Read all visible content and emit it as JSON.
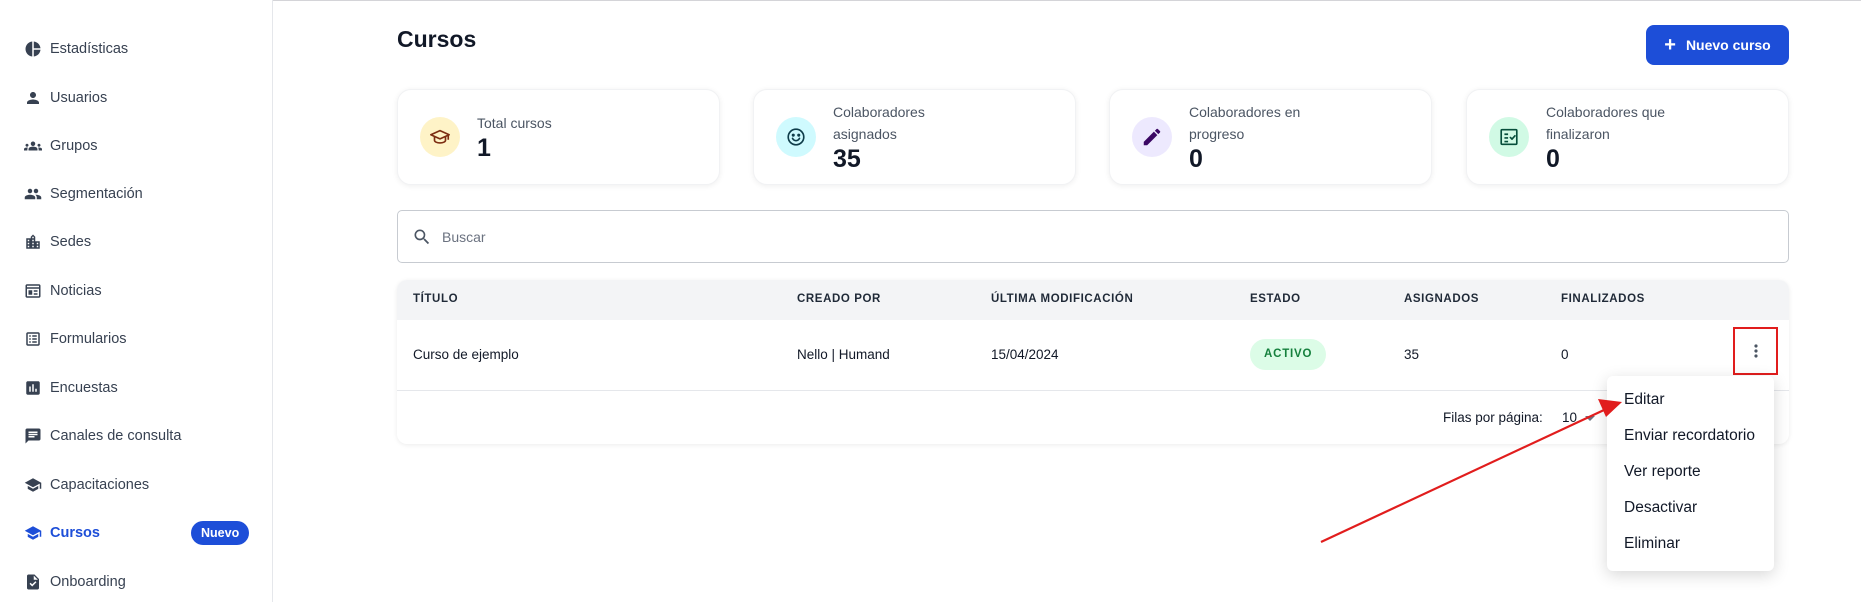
{
  "sidebar": {
    "items": [
      {
        "label": "Estadísticas",
        "icon": "pie-chart-icon"
      },
      {
        "label": "Usuarios",
        "icon": "person-icon"
      },
      {
        "label": "Grupos",
        "icon": "groups-icon"
      },
      {
        "label": "Segmentación",
        "icon": "people-icon"
      },
      {
        "label": "Sedes",
        "icon": "building-icon"
      },
      {
        "label": "Noticias",
        "icon": "news-icon"
      },
      {
        "label": "Formularios",
        "icon": "list-form-icon"
      },
      {
        "label": "Encuestas",
        "icon": "bar-chart-icon"
      },
      {
        "label": "Canales de consulta",
        "icon": "chat-icon"
      },
      {
        "label": "Capacitaciones",
        "icon": "school-icon"
      },
      {
        "label": "Cursos",
        "icon": "school-icon",
        "active": true,
        "badge": "Nuevo"
      },
      {
        "label": "Onboarding",
        "icon": "checklist-doc-icon"
      }
    ]
  },
  "header": {
    "title": "Cursos",
    "new_button": "Nuevo curso"
  },
  "stats": [
    {
      "label": "Total cursos",
      "value": "1",
      "icon": "graduation-cap-icon",
      "color": "#fef3c7"
    },
    {
      "label": "Colaboradores asignados",
      "value": "35",
      "icon": "smiley-icon",
      "color": "#cffafe"
    },
    {
      "label": "Colaboradores en progreso",
      "value": "0",
      "icon": "pencil-icon",
      "color": "#ede9fe"
    },
    {
      "label": "Colaboradores que finalizaron",
      "value": "0",
      "icon": "task-done-icon",
      "color": "#d1fae5"
    }
  ],
  "search": {
    "placeholder": "Buscar"
  },
  "table": {
    "columns": [
      "TÍTULO",
      "CREADO POR",
      "ÚLTIMA MODIFICACIÓN",
      "ESTADO",
      "ASIGNADOS",
      "FINALIZADOS"
    ],
    "rows": [
      {
        "title": "Curso de ejemplo",
        "created_by": "Nello | Humand",
        "modified": "15/04/2024",
        "status": "ACTIVO",
        "assigned": "35",
        "finished": "0"
      }
    ],
    "footer": {
      "rows_per_page_label": "Filas por página:",
      "rows_per_page_value": "10"
    }
  },
  "menu": {
    "items": [
      "Editar",
      "Enviar recordatorio",
      "Ver reporte",
      "Desactivar",
      "Eliminar"
    ]
  },
  "colors": {
    "primary": "#1d4ed8",
    "status_active_bg": "#dcfce7",
    "status_active_text": "#15803d",
    "annotation_red": "#e11d1d"
  }
}
